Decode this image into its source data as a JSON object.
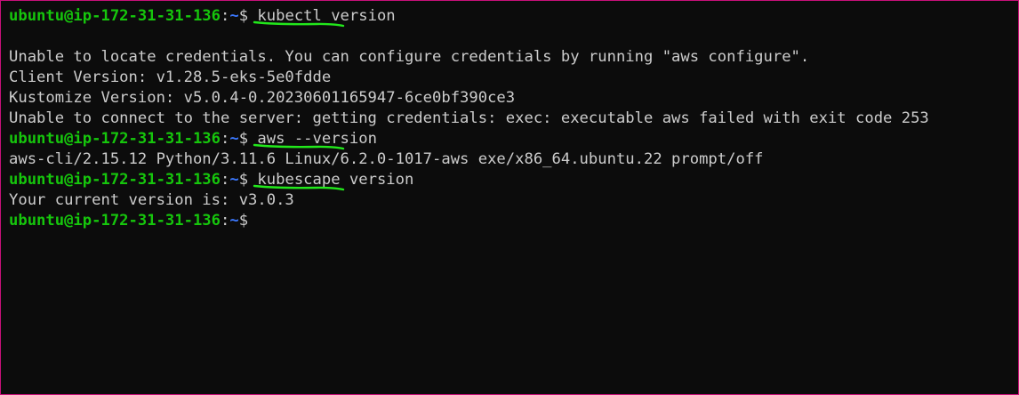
{
  "terminal": {
    "prompt": {
      "user_host": "ubuntu@ip-172-31-31-136",
      "separator": ":",
      "path": "~",
      "symbol": "$ "
    },
    "annotation_color": "#22e81b",
    "lines": [
      {
        "type": "prompt",
        "command": "kubectl version",
        "underlined": true
      },
      {
        "type": "output",
        "text": ""
      },
      {
        "type": "output",
        "text": "Unable to locate credentials. You can configure credentials by running \"aws configure\"."
      },
      {
        "type": "output",
        "text": "Client Version: v1.28.5-eks-5e0fdde"
      },
      {
        "type": "output",
        "text": "Kustomize Version: v5.0.4-0.20230601165947-6ce0bf390ce3"
      },
      {
        "type": "output",
        "text": "Unable to connect to the server: getting credentials: exec: executable aws failed with exit code 253"
      },
      {
        "type": "prompt",
        "command": "aws --version",
        "underlined": true
      },
      {
        "type": "output",
        "text": "aws-cli/2.15.12 Python/3.11.6 Linux/6.2.0-1017-aws exe/x86_64.ubuntu.22 prompt/off"
      },
      {
        "type": "prompt",
        "command": "kubescape version",
        "underlined": true
      },
      {
        "type": "output",
        "text": "Your current version is: v3.0.3"
      },
      {
        "type": "prompt",
        "command": "",
        "underlined": false
      }
    ]
  }
}
